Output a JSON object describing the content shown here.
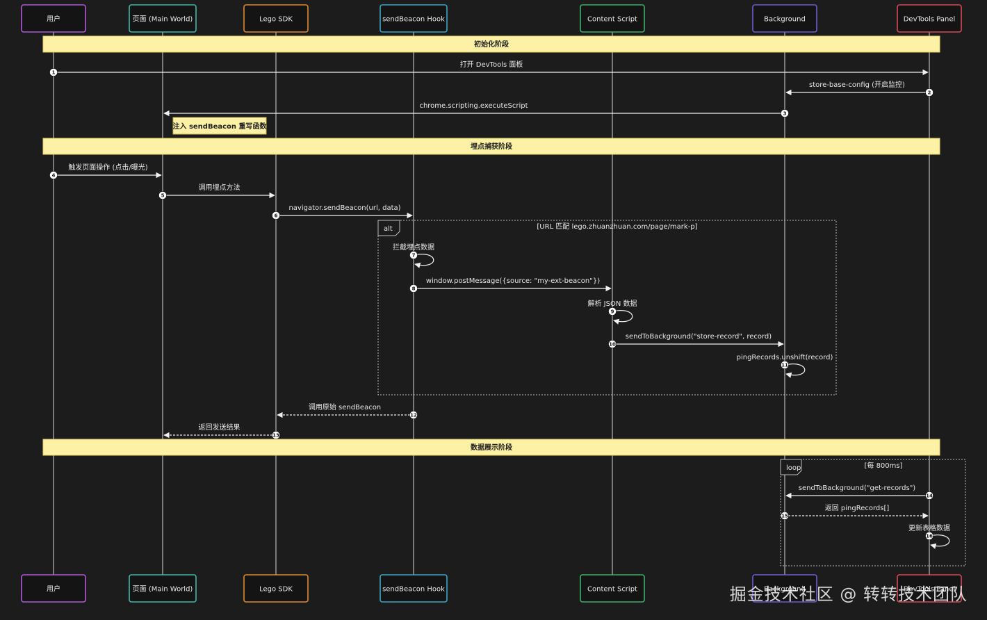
{
  "actors": [
    {
      "id": "user",
      "label": "用户",
      "color": "#b25ad6"
    },
    {
      "id": "page",
      "label": "页面 (Main World)",
      "color": "#3fb8a8"
    },
    {
      "id": "sdk",
      "label": "Lego SDK",
      "color": "#e08a2e"
    },
    {
      "id": "hook",
      "label": "sendBeacon Hook",
      "color": "#3aa7c9"
    },
    {
      "id": "cs",
      "label": "Content Script",
      "color": "#3fae6a"
    },
    {
      "id": "bg",
      "label": "Background",
      "color": "#6a5fd0"
    },
    {
      "id": "panel",
      "label": "DevTools Panel",
      "color": "#d64a5a"
    }
  ],
  "phases": [
    {
      "label": "初始化阶段"
    },
    {
      "label": "埋点捕获阶段"
    },
    {
      "label": "数据展示阶段"
    }
  ],
  "messages": [
    {
      "n": "1",
      "from": "user",
      "to": "panel",
      "label": "打开 DevTools 面板",
      "style": "solid"
    },
    {
      "n": "2",
      "from": "panel",
      "to": "bg",
      "label": "store-base-config (开启监控)",
      "style": "solid"
    },
    {
      "n": "3",
      "from": "bg",
      "to": "page",
      "label": "chrome.scripting.executeScript",
      "style": "solid"
    },
    {
      "n": "4",
      "from": "user",
      "to": "page",
      "label": "触发页面操作 (点击/曝光)",
      "style": "solid"
    },
    {
      "n": "5",
      "from": "page",
      "to": "sdk",
      "label": "调用埋点方法",
      "style": "solid"
    },
    {
      "n": "6",
      "from": "sdk",
      "to": "hook",
      "label": "navigator.sendBeacon(url, data)",
      "style": "solid"
    },
    {
      "n": "7",
      "from": "hook",
      "to": "hook",
      "label": "拦截埋点数据",
      "style": "self"
    },
    {
      "n": "8",
      "from": "hook",
      "to": "cs",
      "label": "window.postMessage({source: \"my-ext-beacon\"})",
      "style": "solid"
    },
    {
      "n": "9",
      "from": "cs",
      "to": "cs",
      "label": "解析 JSON 数据",
      "style": "self"
    },
    {
      "n": "10",
      "from": "cs",
      "to": "bg",
      "label": "sendToBackground(\"store-record\", record)",
      "style": "solid"
    },
    {
      "n": "11",
      "from": "bg",
      "to": "bg",
      "label": "pingRecords.unshift(record)",
      "style": "self"
    },
    {
      "n": "12",
      "from": "hook",
      "to": "sdk",
      "label": "调用原始 sendBeacon",
      "style": "dashed"
    },
    {
      "n": "13",
      "from": "sdk",
      "to": "page",
      "label": "返回发送结果",
      "style": "dashed"
    },
    {
      "n": "14",
      "from": "panel",
      "to": "bg",
      "label": "sendToBackground(\"get-records\")",
      "style": "solid"
    },
    {
      "n": "15",
      "from": "bg",
      "to": "panel",
      "label": "返回 pingRecords[]",
      "style": "dashed"
    },
    {
      "n": "16",
      "from": "panel",
      "to": "panel",
      "label": "更新表格数据",
      "style": "self"
    }
  ],
  "note": {
    "label": "注入 sendBeacon 重写函数"
  },
  "frames": [
    {
      "kind": "alt",
      "condition": "[URL 匹配 lego.zhuanzhuan.com/page/mark-p]"
    },
    {
      "kind": "loop",
      "condition": "[每 800ms]"
    }
  ],
  "watermark": "掘金技术社区 @ 转转技术团队"
}
